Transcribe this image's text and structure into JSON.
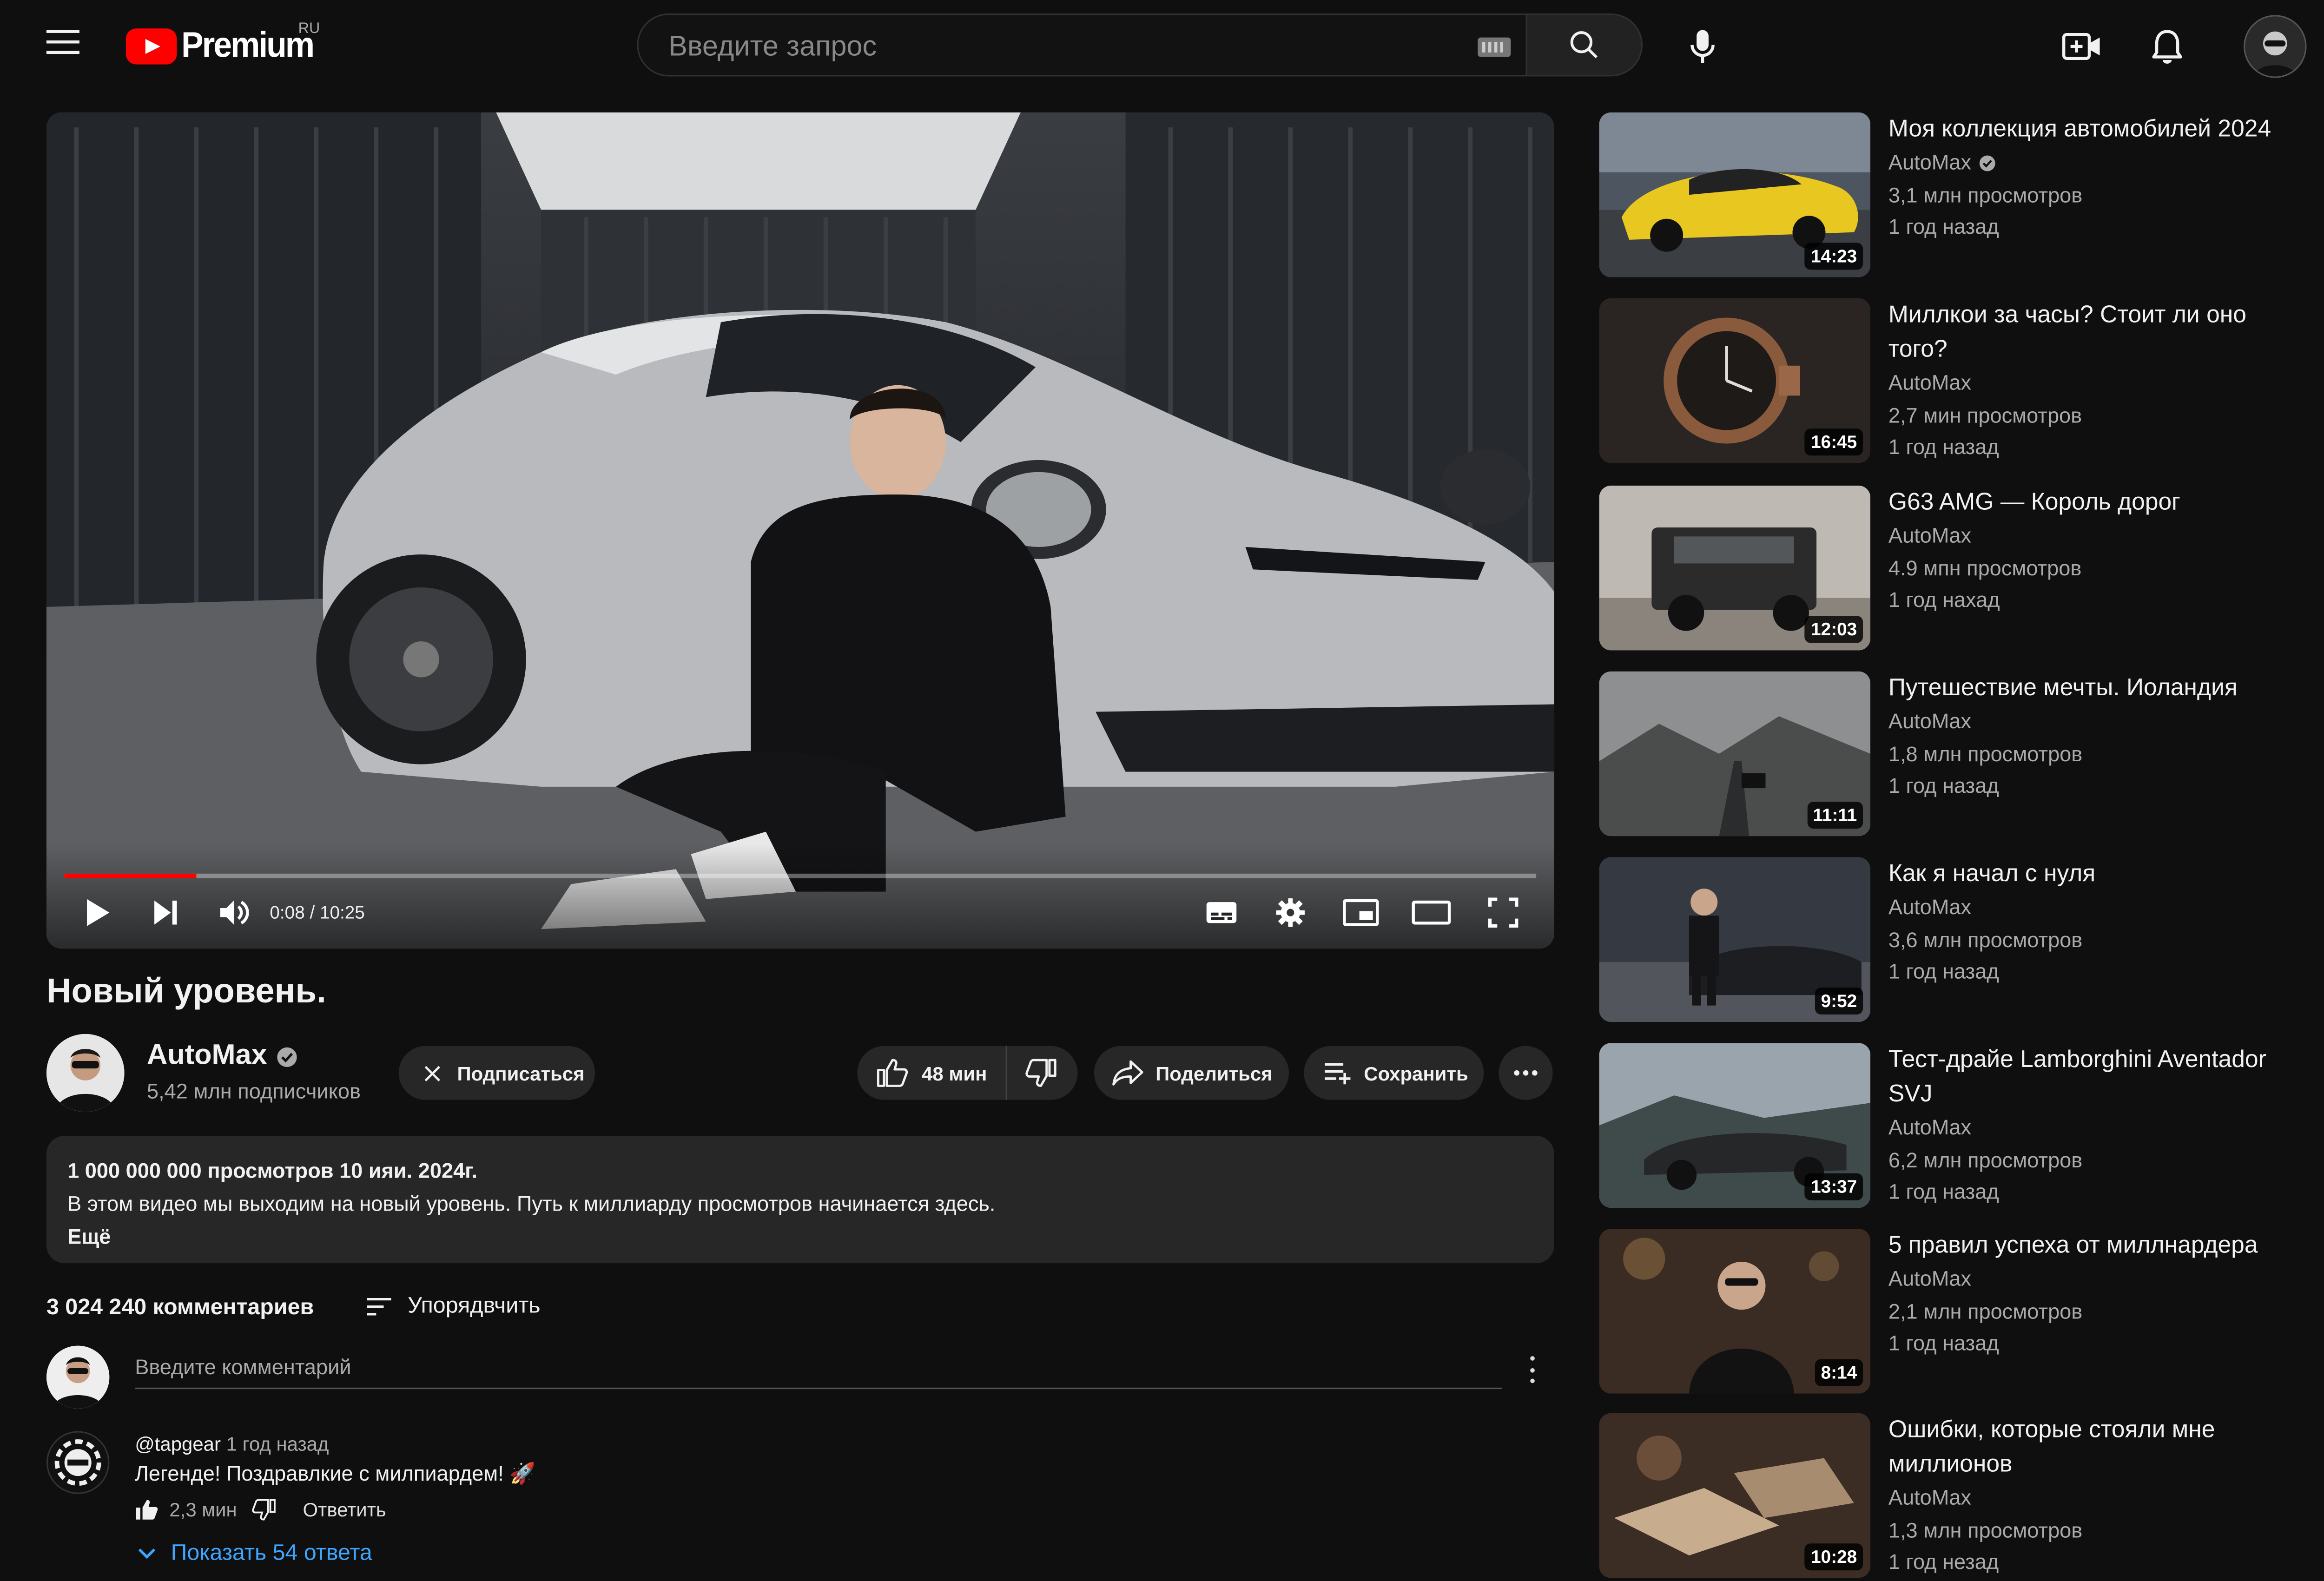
{
  "header": {
    "logo_text": "Premium",
    "region": "RU",
    "search_placeholder": "Введите запрос"
  },
  "player": {
    "time": "0:08 / 10:25",
    "progress_fraction": 0.09
  },
  "video": {
    "title": "Новый уровень.",
    "channel_name": "AutoMax",
    "subscribers": "5,42 млн подписчиков",
    "subscribe_label": "Подписаться",
    "like_count": "48 мин",
    "share_label": "Поделиться",
    "save_label": "Сохранить"
  },
  "description": {
    "meta": "1 000 000 000 просмотров  10 ияи. 2024г.",
    "text": "В этом видео мы выходим на новый уровень. Путь к миллиарду просмотров начинается здесь.",
    "more": "Ещё"
  },
  "comments": {
    "count": "3 024 240 комментариев",
    "sort_label": "Упорядвчить",
    "input_placeholder": "Введите комментарий",
    "items": [
      {
        "author": "@tapgear",
        "when": "1 год назад",
        "text": "Легенде! Поздравлкие с милпиардем! 🚀",
        "likes": "2,3 мин",
        "reply": "Ответить",
        "show_replies": "Показать 54 ответа"
      }
    ]
  },
  "recommendations": [
    {
      "title": "Моя коллекция автомобилей 2024",
      "channel": "AutoMax",
      "verified": true,
      "views": "3,1 млн просмотров",
      "age": "1 год назад",
      "duration": "14:23"
    },
    {
      "title": "Миллкои за часы? Стоит ли оно того?",
      "channel": "AutoMax",
      "verified": false,
      "views": "2,7 мин просмотров",
      "age": "1 год назад",
      "duration": "16:45"
    },
    {
      "title": "G63 AMG — Король дорог",
      "channel": "AutoMax",
      "verified": false,
      "views": "4.9 мпн просмотров",
      "age": "1 год нахад",
      "duration": "12:03"
    },
    {
      "title": "Путешествие мечты. Иоландия",
      "channel": "AutoMax",
      "verified": false,
      "views": "1,8 млн просмотров",
      "age": "1 год назад",
      "duration": "11:11"
    },
    {
      "title": "Как я начал с нуля",
      "channel": "AutoMax",
      "verified": false,
      "views": "3,6 млн просмотров",
      "age": "1 год назад",
      "duration": "9:52"
    },
    {
      "title": "Тест-драйе Lamborghini Aventador SVJ",
      "channel": "AutoMax",
      "verified": false,
      "views": "6,2 млн просмотров",
      "age": "1 год назад",
      "duration": "13:37"
    },
    {
      "title": "5 правил успеха от миллнардера",
      "channel": "AutoMax",
      "verified": false,
      "views": "2,1 млн просмотров",
      "age": "1 год назад",
      "duration": "8:14"
    },
    {
      "title": "Ошибки, которые стояли мне миллионов",
      "channel": "AutoMax",
      "verified": false,
      "views": "1,3 млн просмотров",
      "age": "1 год незад",
      "duration": "10:28"
    }
  ],
  "colors": {
    "background": "#0f0f0f",
    "brand_red": "#ff0000",
    "link_blue": "#3ea6ff",
    "pill_bg": "#272727"
  }
}
